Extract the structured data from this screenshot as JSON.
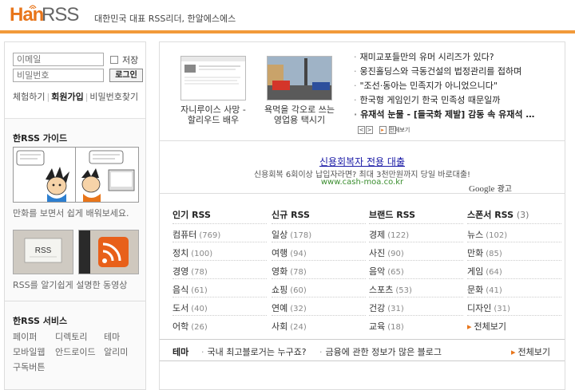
{
  "header": {
    "logo_han": "Han",
    "logo_rss": "RSS",
    "tagline": "대한민국 대표 RSS리더, 한알에스에스",
    "accent_color": "#f29a3a"
  },
  "login": {
    "id_placeholder": "이메일",
    "pw_placeholder": "비밀번호",
    "remember_label": "저장",
    "login_button": "로그인",
    "links": [
      "체험하기",
      "회원가입",
      "비밀번호찾기"
    ]
  },
  "guide": {
    "title": "한RSS 가이드",
    "comic_caption": "만화를 보면서 쉽게 배워보세요.",
    "video_caption": "RSS를 알기쉽게 설명한 동영상",
    "video_icon_text": "RSS"
  },
  "services": {
    "title": "한RSS 서비스",
    "items": [
      "페이퍼",
      "디렉토리",
      "테마",
      "모바일웹",
      "안드로이드",
      "알리미",
      "구독버튼"
    ]
  },
  "featured": {
    "thumbs": [
      {
        "caption": "자니루이스 사망 - 할리우드 배우"
      },
      {
        "caption": "욕먹을 각오로 쓰는 영업용 택시기"
      }
    ],
    "news": [
      {
        "text": "재미교포들만의 유머 시리즈가 있다?",
        "strong": false
      },
      {
        "text": "웅진홀딩스와 극동건설의 법정관리를 접하며",
        "strong": false
      },
      {
        "text": "\"조선·동아는 민족지가 아니었으니다\"",
        "strong": false
      },
      {
        "text": "한국형 게임인기 한국 민족성 때문일까",
        "strong": false
      },
      {
        "text": "유재석 눈물 - [들국화 제발] 감동 속 유재석 …",
        "strong": true
      }
    ],
    "pager_prev": "<",
    "pager_next": ">",
    "more_label": "전체보기"
  },
  "ad": {
    "title": "신용회복자 전용 대출",
    "desc": "신용회복 6회이상 납입자라면? 최대 3천만원까지 당일 바로대출!",
    "url": "www.cash-moa.co.kr",
    "google": "Google",
    "mark": "광고"
  },
  "categories": [
    {
      "title": "인기 RSS",
      "count": "",
      "items": [
        {
          "name": "컴퓨터",
          "count": "(769)"
        },
        {
          "name": "정치",
          "count": "(100)"
        },
        {
          "name": "경영",
          "count": "(78)"
        },
        {
          "name": "음식",
          "count": "(61)"
        },
        {
          "name": "도서",
          "count": "(40)"
        },
        {
          "name": "어학",
          "count": "(26)"
        }
      ]
    },
    {
      "title": "신규 RSS",
      "count": "",
      "items": [
        {
          "name": "일상",
          "count": "(178)"
        },
        {
          "name": "여행",
          "count": "(94)"
        },
        {
          "name": "영화",
          "count": "(78)"
        },
        {
          "name": "쇼핑",
          "count": "(60)"
        },
        {
          "name": "연예",
          "count": "(32)"
        },
        {
          "name": "사회",
          "count": "(24)"
        }
      ]
    },
    {
      "title": "브랜드 RSS",
      "count": "",
      "items": [
        {
          "name": "경제",
          "count": "(122)"
        },
        {
          "name": "사진",
          "count": "(90)"
        },
        {
          "name": "음악",
          "count": "(65)"
        },
        {
          "name": "스포츠",
          "count": "(53)"
        },
        {
          "name": "건강",
          "count": "(31)"
        },
        {
          "name": "교육",
          "count": "(18)"
        }
      ]
    },
    {
      "title": "스폰서 RSS",
      "count": "(3)",
      "items": [
        {
          "name": "뉴스",
          "count": "(102)"
        },
        {
          "name": "만화",
          "count": "(85)"
        },
        {
          "name": "게임",
          "count": "(64)"
        },
        {
          "name": "문화",
          "count": "(41)"
        },
        {
          "name": "디자인",
          "count": "(31)"
        },
        {
          "name": "전체보기",
          "count": "",
          "more": true
        }
      ]
    }
  ],
  "theme": {
    "label": "테마",
    "items": [
      "국내 최고블로거는 누구죠?",
      "금융에 관한 정보가 많은 블로그"
    ],
    "more_label": "전체보기"
  }
}
